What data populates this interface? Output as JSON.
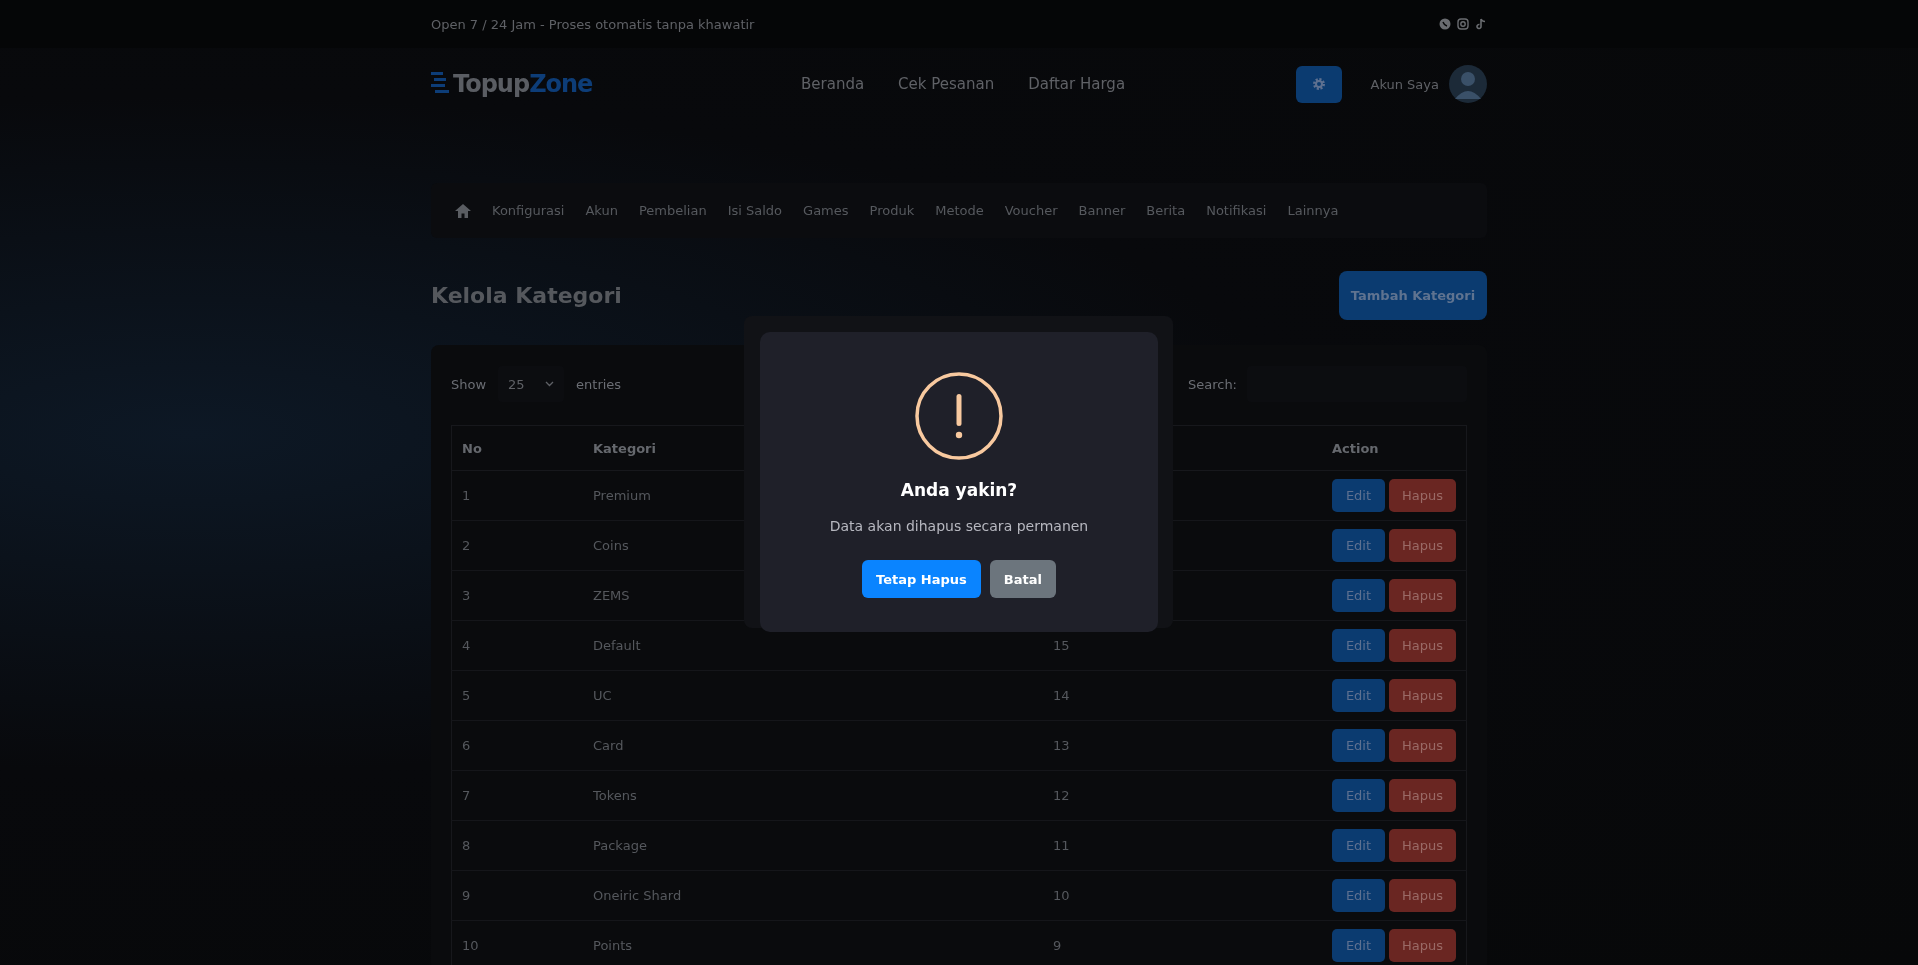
{
  "top_bar": {
    "tagline": "Open 7 / 24 Jam - Proses otomatis tanpa khawatir"
  },
  "header": {
    "logo_text": "Topup",
    "logo_accent": "Zone",
    "nav_links": [
      "Beranda",
      "Cek Pesanan",
      "Daftar Harga"
    ],
    "account_label": "Akun Saya"
  },
  "admin_menu": [
    "Konfigurasi",
    "Akun",
    "Pembelian",
    "Isi Saldo",
    "Games",
    "Produk",
    "Metode",
    "Voucher",
    "Banner",
    "Berita",
    "Notifikasi",
    "Lainnya"
  ],
  "page_title": "Kelola Kategori",
  "add_button": "Tambah Kategori",
  "table_controls": {
    "show_label": "Show",
    "page_size": "25",
    "entries_label": "entries",
    "search_label": "Search:"
  },
  "table": {
    "columns": {
      "no": "No",
      "kategori": "Kategori",
      "action": "Action"
    },
    "rows": [
      {
        "no": "1",
        "kategori": "Premium",
        "edit": "Edit",
        "delete": "Hapus"
      },
      {
        "no": "2",
        "kategori": "Coins",
        "edit": "Edit",
        "delete": "Hapus"
      },
      {
        "no": "3",
        "kategori": "ZEMS",
        "edit": "Edit",
        "delete": "Hapus"
      },
      {
        "no": "4",
        "kategori": "Default",
        "column_3": "15",
        "edit": "Edit",
        "delete": "Hapus"
      },
      {
        "no": "5",
        "kategori": "UC",
        "column_3": "14",
        "edit": "Edit",
        "delete": "Hapus"
      },
      {
        "no": "6",
        "kategori": "Card",
        "column_3": "13",
        "edit": "Edit",
        "delete": "Hapus"
      },
      {
        "no": "7",
        "kategori": "Tokens",
        "column_3": "12",
        "edit": "Edit",
        "delete": "Hapus"
      },
      {
        "no": "8",
        "kategori": "Package",
        "column_3": "11",
        "edit": "Edit",
        "delete": "Hapus"
      },
      {
        "no": "9",
        "kategori": "Oneiric Shard",
        "column_3": "10",
        "edit": "Edit",
        "delete": "Hapus"
      },
      {
        "no": "10",
        "kategori": "Points",
        "column_3": "9",
        "edit": "Edit",
        "delete": "Hapus"
      }
    ]
  },
  "dialog": {
    "title": "Anda yakin?",
    "message": "Data akan dihapus secara permanen",
    "confirm": "Tetap Hapus",
    "cancel": "Batal"
  }
}
